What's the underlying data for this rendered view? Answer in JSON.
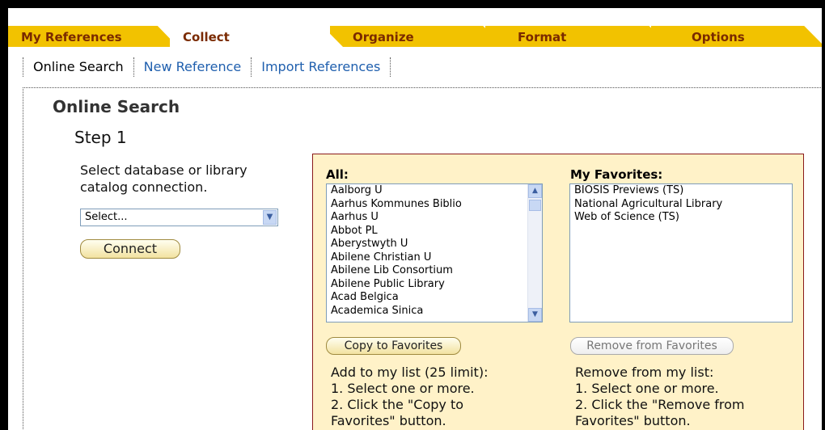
{
  "tabs": {
    "my_references": "My References",
    "collect": "Collect",
    "organize": "Organize",
    "format": "Format",
    "options": "Options"
  },
  "subnav": {
    "online_search": "Online Search",
    "new_reference": "New Reference",
    "import_references": "Import References"
  },
  "page": {
    "title": "Online Search",
    "step": "Step 1",
    "instruction": "Select database or library catalog connection.",
    "select_value": "Select...",
    "connect_label": "Connect"
  },
  "panel": {
    "all_label": "All:",
    "favorites_label": "My Favorites:",
    "all_items": [
      "Aalborg U",
      "Aarhus Kommunes Biblio",
      "Aarhus U",
      "Abbot PL",
      "Aberystwyth U",
      "Abilene Christian U",
      "Abilene Lib Consortium",
      "Abilene Public Library",
      "Acad Belgica",
      "Academica Sinica"
    ],
    "favorite_items": [
      "BIOSIS Previews (TS)",
      "National Agricultural Library",
      "Web of Science (TS)"
    ],
    "copy_label": "Copy to Favorites",
    "remove_label": "Remove from Favorites",
    "add_help": [
      "Add to my list (25 limit):",
      "1. Select one or more.",
      "2. Click the \"Copy to",
      "Favorites\" button."
    ],
    "remove_help": [
      "Remove from my list:",
      "1. Select one or more.",
      "2. Click the \"Remove from",
      "Favorites\" button."
    ]
  },
  "colors": {
    "tab_gold": "#f2c200",
    "tab_text": "#7a2a00",
    "link_blue": "#1f5fae",
    "panel_bg": "#fff2c8",
    "panel_border": "#8a1a1a"
  }
}
